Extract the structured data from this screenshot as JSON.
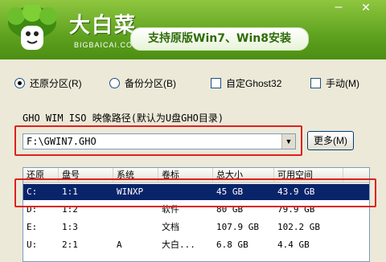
{
  "header": {
    "logo_title": "大白菜",
    "logo_sub": "BIGBAICAI.COM",
    "slogan": "支持原版Win7、Win8安装",
    "minimize": "–",
    "close": "✕"
  },
  "options": {
    "restore": "还原分区(R)",
    "backup": "备份分区(B)",
    "custom_ghost": "自定Ghost32",
    "manual": "手动(M)",
    "selected": "restore"
  },
  "path": {
    "label": "GHO WIM ISO 映像路径(默认为U盘GHO目录)",
    "value": "F:\\GWIN7.GHO",
    "more_button": "更多(M)"
  },
  "table": {
    "columns": [
      "还原",
      "盘号",
      "系统",
      "卷标",
      "总大小",
      "可用空间"
    ],
    "rows": [
      [
        "C:",
        "1:1",
        "WINXP",
        "",
        "45 GB",
        "43.9 GB"
      ],
      [
        "D:",
        "1:2",
        "",
        "软件",
        "80 GB",
        "79.9 GB"
      ],
      [
        "E:",
        "1:3",
        "",
        "文档",
        "107.9 GB",
        "102.2 GB"
      ],
      [
        "U:",
        "2:1",
        "A",
        "大白...",
        "6.8 GB",
        "4.4 GB"
      ]
    ],
    "selected_row": 0
  },
  "colors": {
    "banner": "#5ea21f",
    "highlight_box": "#e02020",
    "selection": "#0a246a"
  }
}
